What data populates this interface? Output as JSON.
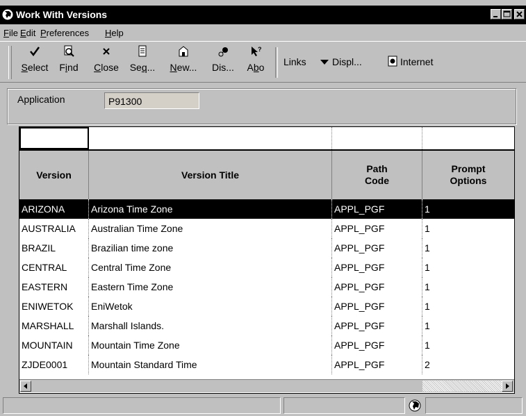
{
  "window": {
    "title": "Work With Versions",
    "controls": [
      "minimize",
      "maximize",
      "close"
    ]
  },
  "menu": [
    {
      "label": "File",
      "key": "F",
      "rest": "ile"
    },
    {
      "label": "Edit",
      "key": "E",
      "rest": "dit"
    },
    {
      "label": "Preferences",
      "key": "P",
      "rest": "references"
    },
    {
      "label": "Help",
      "key": "H",
      "rest": "elp"
    }
  ],
  "toolbar": {
    "buttons": [
      {
        "name": "select",
        "pre": "",
        "key": "S",
        "post": "elect",
        "icon": "check-icon"
      },
      {
        "name": "find",
        "pre": "F",
        "key": "i",
        "post": "nd",
        "icon": "find-icon"
      },
      {
        "name": "close",
        "pre": "",
        "key": "C",
        "post": "lose",
        "icon": "close-x-icon"
      },
      {
        "name": "seq",
        "pre": "Se",
        "key": "q",
        "post": "...",
        "icon": "sequence-icon"
      },
      {
        "name": "new",
        "pre": "",
        "key": "N",
        "post": "ew...",
        "icon": "new-icon"
      },
      {
        "name": "dis",
        "pre": "Dis...",
        "key": "",
        "post": "",
        "icon": "display-icon"
      },
      {
        "name": "abo",
        "pre": "A",
        "key": "b",
        "post": "o",
        "icon": "about-icon"
      }
    ],
    "links_label": "Links",
    "display_label": "Displ...",
    "internet_label": "Internet"
  },
  "application": {
    "label": "Application",
    "value": "P91300"
  },
  "grid": {
    "columns": [
      {
        "key": "version",
        "label": "Version"
      },
      {
        "key": "title",
        "label": "Version Title"
      },
      {
        "key": "path",
        "label": "Path Code"
      },
      {
        "key": "prompt",
        "label": "Prompt Options"
      }
    ],
    "selected_index": 0,
    "rows": [
      {
        "version": "ARIZONA",
        "title": "Arizona Time Zone",
        "path": "APPL_PGF",
        "prompt": "1"
      },
      {
        "version": "AUSTRALIA",
        "title": "Australian Time Zone",
        "path": "APPL_PGF",
        "prompt": "1"
      },
      {
        "version": "BRAZIL",
        "title": "Brazilian time zone",
        "path": "APPL_PGF",
        "prompt": "1"
      },
      {
        "version": "CENTRAL",
        "title": "Central Time Zone",
        "path": "APPL_PGF",
        "prompt": "1"
      },
      {
        "version": "EASTERN",
        "title": "Eastern Time Zone",
        "path": "APPL_PGF",
        "prompt": "1"
      },
      {
        "version": "ENIWETOK",
        "title": "EniWetok",
        "path": "APPL_PGF",
        "prompt": "1"
      },
      {
        "version": "MARSHALL",
        "title": "Marshall Islands.",
        "path": "APPL_PGF",
        "prompt": "1"
      },
      {
        "version": "MOUNTAIN",
        "title": "Mountain Time Zone",
        "path": "APPL_PGF",
        "prompt": "1"
      },
      {
        "version": "ZJDE0001",
        "title": "Mountain Standard Time",
        "path": "APPL_PGF",
        "prompt": "2"
      }
    ]
  },
  "colors": {
    "chrome": "#c0c0c0",
    "titlebar": "#000000",
    "selection": "#000000"
  }
}
